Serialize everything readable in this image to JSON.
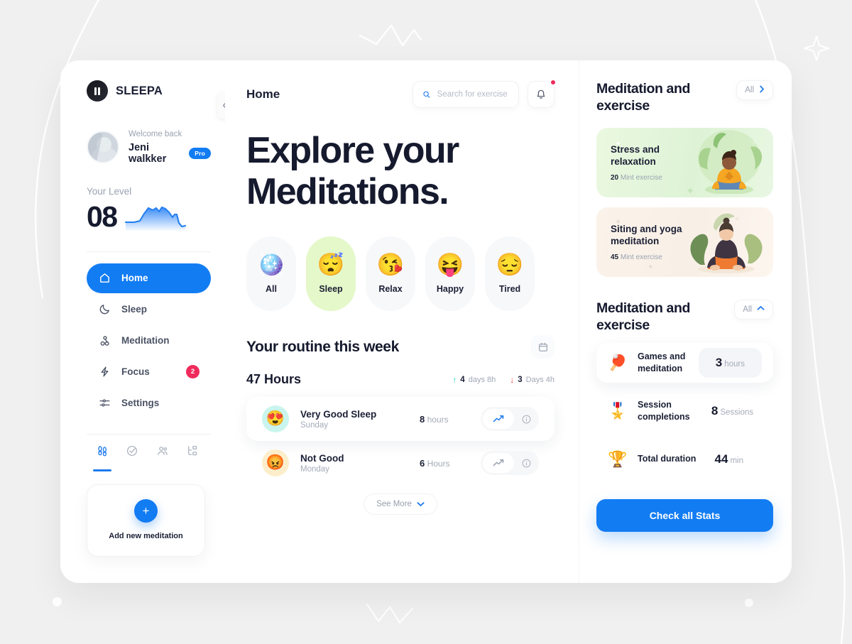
{
  "brand": {
    "name": "SLEEPA",
    "logo_icon": "pause-icon"
  },
  "sidebar": {
    "profile": {
      "welcome": "Welcome back",
      "username": "Jeni walkker",
      "badge": "Pro"
    },
    "level": {
      "label": "Your Level",
      "value": "08"
    },
    "nav": [
      {
        "label": "Home",
        "icon": "home-icon",
        "badge": ""
      },
      {
        "label": "Sleep",
        "icon": "moon-icon",
        "badge": ""
      },
      {
        "label": "Meditation",
        "icon": "meditation-icon",
        "badge": ""
      },
      {
        "label": "Focus",
        "icon": "bolt-icon",
        "badge": "2"
      },
      {
        "label": "Settings",
        "icon": "sliders-icon",
        "badge": ""
      }
    ],
    "tabs": [
      {
        "icon": "footsteps-icon"
      },
      {
        "icon": "check-circle-icon"
      },
      {
        "icon": "people-icon"
      },
      {
        "icon": "hierarchy-icon"
      }
    ],
    "add_card": {
      "label": "Add new meditation",
      "icon": "plus-icon"
    },
    "collapse_icon": "chevron-left-icon"
  },
  "header": {
    "title": "Home",
    "search": {
      "placeholder": "Search for exercise",
      "value": "",
      "icon": "search-icon"
    },
    "notifications": {
      "icon": "bell-icon",
      "has_unread": true
    }
  },
  "main": {
    "hero_line1": "Explore your",
    "hero_line2": "Meditations.",
    "moods": [
      {
        "label": "All",
        "emoji": "🪩",
        "selected": false
      },
      {
        "label": "Sleep",
        "emoji": "😴",
        "selected": true
      },
      {
        "label": "Relax",
        "emoji": "😘",
        "selected": false
      },
      {
        "label": "Happy",
        "emoji": "😝",
        "selected": false
      },
      {
        "label": "Tired",
        "emoji": "😔",
        "selected": false
      }
    ],
    "routine": {
      "title": "Your routine this week",
      "calendar_icon": "calendar-icon",
      "total": "47 Hours",
      "delta_up": {
        "value": "4",
        "unit": "days 8h",
        "icon": "arrow-up-icon"
      },
      "delta_down": {
        "value": "3",
        "unit": "Days 4h",
        "icon": "arrow-down-icon"
      }
    },
    "sleep_entries": [
      {
        "name": "Very Good Sleep",
        "day": "Sunday",
        "value": "8",
        "unit": "hours",
        "emoji": "😍",
        "emoji_bg": "#c9f5ee",
        "highlighted": true
      },
      {
        "name": "Not Good",
        "day": "Monday",
        "value": "6",
        "unit": "Hours",
        "emoji": "😡",
        "emoji_bg": "#fdeecb",
        "highlighted": false
      }
    ],
    "see_more": {
      "label": "See More",
      "icon": "chevron-down-icon"
    }
  },
  "right": {
    "section1": {
      "title": "Meditation and exercise",
      "all_label": "All",
      "all_icon": "chevron-right-icon"
    },
    "promos": [
      {
        "title": "Stress and relaxation",
        "duration": "20",
        "unit": "Mint exercise",
        "theme": "green"
      },
      {
        "title": "Siting and yoga meditation",
        "duration": "45",
        "unit": "Mint exercise",
        "theme": "cream"
      }
    ],
    "section2": {
      "title": "Meditation and exercise",
      "all_label": "All",
      "all_icon": "chevron-up-icon"
    },
    "stats": [
      {
        "name": "Games and meditation",
        "value": "3",
        "unit": "hours",
        "emoji": "🏓",
        "highlighted": true
      },
      {
        "name": "Session completions",
        "value": "8",
        "unit": "Sessions",
        "emoji": "🎖️",
        "highlighted": false
      },
      {
        "name": "Total duration",
        "value": "44",
        "unit": "min",
        "emoji": "🏆",
        "highlighted": false
      }
    ],
    "cta_label": "Check all Stats"
  },
  "colors": {
    "accent": "#127cf3",
    "danger": "#ef2b5b",
    "up": "#16d3b6",
    "down": "#f0433f",
    "selected_mood_bg": "#e4f8c9",
    "text_dark": "#161a2e",
    "text_muted": "#9aa2b1",
    "page_bg": "#f0f0f0"
  }
}
